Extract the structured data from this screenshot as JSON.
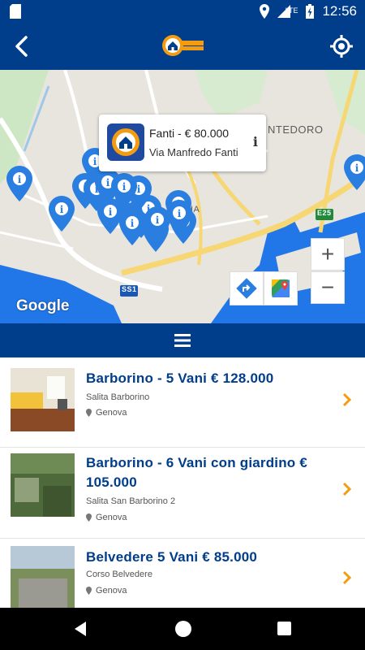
{
  "status_bar": {
    "time": "12:56",
    "network_label": "LTE",
    "icons": [
      "sd-card-icon",
      "location-icon",
      "signal-icon",
      "battery-icon"
    ]
  },
  "app_bar": {
    "back_icon": "back-arrow-icon",
    "logo_icon": "gdb-immobiliare-logo",
    "locate_icon": "crosshair-icon"
  },
  "map": {
    "labels": {
      "district": "NTEDORO",
      "area": "NA",
      "highway": "E25",
      "road": "SS1"
    },
    "callout": {
      "title": "Fanti - € 80.000",
      "address": "Via Manfredo Fanti",
      "info_glyph": "i"
    },
    "controls": {
      "zoom_in": "+",
      "zoom_out": "−",
      "route_icon": "directions-icon",
      "maps_icon": "google-maps-icon"
    },
    "attribution": "Google",
    "pin_glyph": "i"
  },
  "menu": {
    "icon": "hamburger-menu-icon"
  },
  "listings": [
    {
      "title": "Barborino - 5 Vani € 128.000",
      "street": "Salita Barborino",
      "city": "Genova"
    },
    {
      "title": "Barborino - 6 Vani con giardino € 105.000",
      "street": "Salita San Barborino 2",
      "city": "Genova"
    },
    {
      "title": "Belvedere 5 Vani € 85.000",
      "street": "Corso Belvedere",
      "city": "Genova"
    }
  ],
  "colors": {
    "primary": "#003d8a",
    "accent": "#f39c12",
    "pin": "#2a7ee0"
  }
}
